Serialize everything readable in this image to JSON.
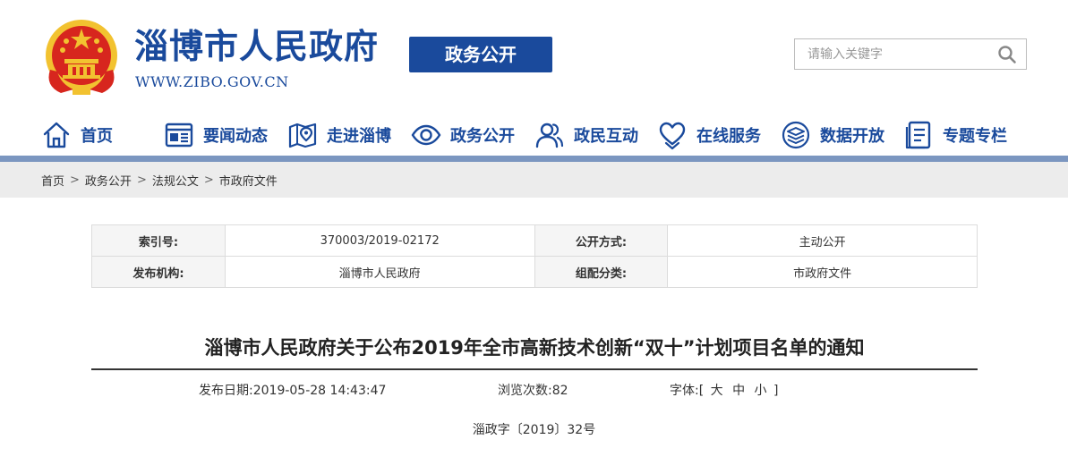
{
  "header": {
    "site_title": "淄博市人民政府",
    "site_url": "WWW.ZIBO.GOV.CN",
    "section_badge": "政务公开",
    "search": {
      "placeholder": "请输入关键字",
      "value": ""
    }
  },
  "nav": {
    "items": [
      {
        "label": "首页",
        "icon": "home-icon"
      },
      {
        "label": "要闻动态",
        "icon": "news-icon"
      },
      {
        "label": "走进淄博",
        "icon": "map-location-icon"
      },
      {
        "label": "政务公开",
        "icon": "eye-icon"
      },
      {
        "label": "政民互动",
        "icon": "users-icon"
      },
      {
        "label": "在线服务",
        "icon": "heart-hands-icon"
      },
      {
        "label": "数据开放",
        "icon": "database-layers-icon"
      },
      {
        "label": "专题专栏",
        "icon": "document-list-icon"
      }
    ]
  },
  "breadcrumb": {
    "items": [
      "首页",
      "政务公开",
      "法规公文",
      "市政府文件"
    ],
    "separator": ">"
  },
  "info": {
    "index_label": "索引号:",
    "index_value": "370003/2019-02172",
    "method_label": "公开方式:",
    "method_value": "主动公开",
    "publisher_label": "发布机构:",
    "publisher_value": "淄博市人民政府",
    "category_label": "组配分类:",
    "category_value": "市政府文件"
  },
  "article": {
    "title": "淄博市人民政府关于公布2019年全市高新技术创新“双十”计划项目名单的通知",
    "date_label": "发布日期:",
    "date_value": "2019-05-28 14:43:47",
    "views_label": "浏览次数:",
    "views_value": "82",
    "font_label": "字体:",
    "font_open": "[",
    "font_large": "大",
    "font_medium": "中",
    "font_small": "小",
    "font_close": "]",
    "doc_number": "淄政字〔2019〕32号"
  },
  "colors": {
    "brand_blue": "#1a4a9c",
    "nav_bar": "#7b96c0",
    "breadcrumb_bg": "#ececec",
    "emblem_red": "#d7261e",
    "emblem_gold": "#f2c230"
  }
}
